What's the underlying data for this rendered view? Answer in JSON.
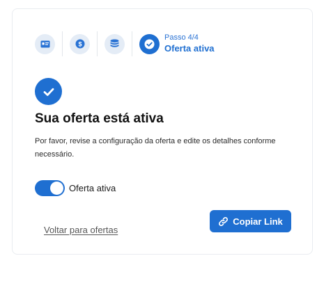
{
  "stepper": {
    "steps": [
      {
        "icon": "id-card-icon"
      },
      {
        "icon": "dollar-coin-icon"
      },
      {
        "icon": "coin-stack-icon"
      },
      {
        "icon": "check-circle-icon"
      }
    ],
    "current_step_label": "Passo 4/4",
    "current_step_title": "Oferta ativa"
  },
  "main": {
    "status_icon": "check-icon",
    "title": "Sua oferta está ativa",
    "description": "Por favor, revise a configuração da oferta e edite os detalhes conforme necessário."
  },
  "toggle": {
    "label": "Oferta ativa",
    "checked": true
  },
  "actions": {
    "back_link": "Voltar para ofertas",
    "copy_button": "Copiar Link"
  },
  "colors": {
    "primary": "#1f6fd1",
    "step_bg": "#e4ecf6"
  }
}
